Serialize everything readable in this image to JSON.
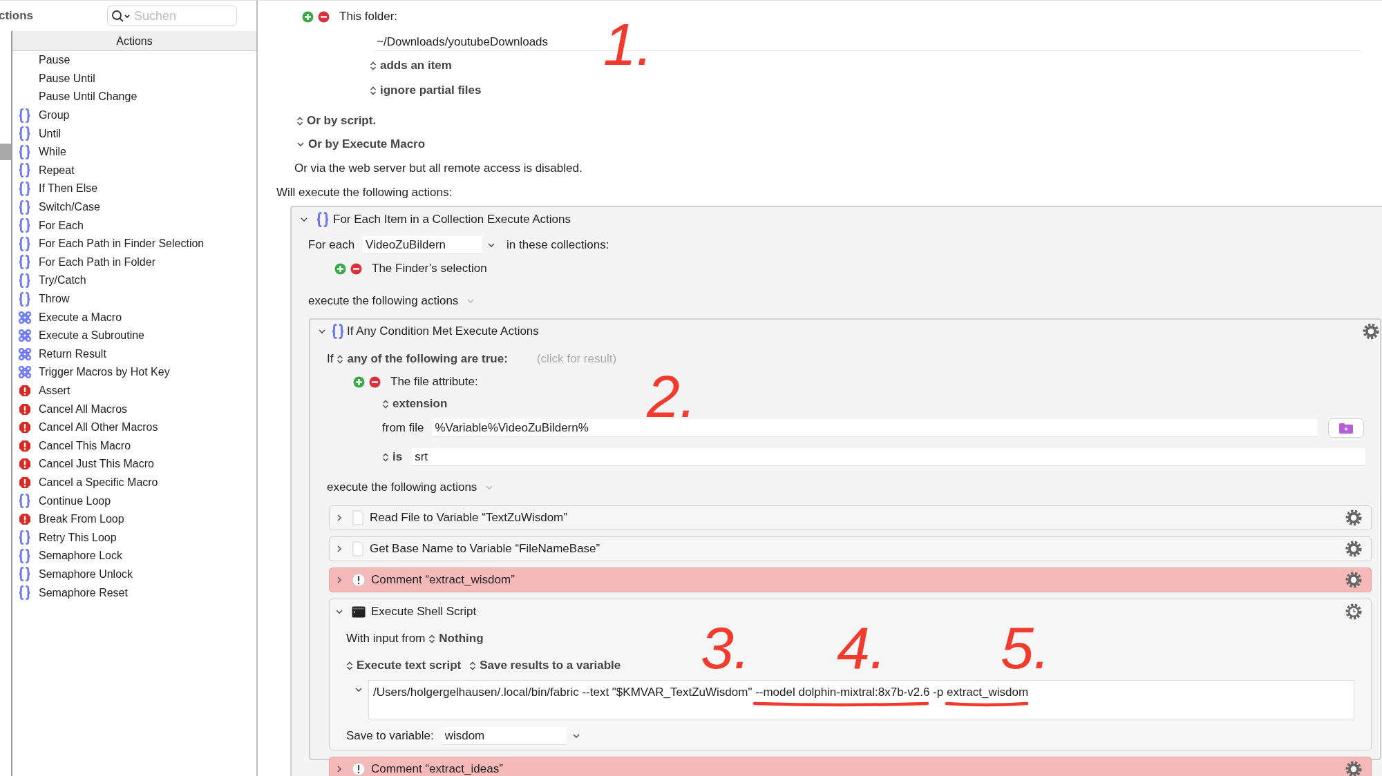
{
  "sidebar": {
    "title": "ctions",
    "search": {
      "placeholder": "Suchen"
    },
    "column_header": "Actions",
    "items": [
      {
        "label": "Pause",
        "kind": "plain"
      },
      {
        "label": "Pause Until",
        "kind": "plain"
      },
      {
        "label": "Pause Until Change",
        "kind": "plain"
      },
      {
        "label": "Group",
        "kind": "braces"
      },
      {
        "label": "Until",
        "kind": "braces"
      },
      {
        "label": "While",
        "kind": "braces"
      },
      {
        "label": "Repeat",
        "kind": "braces"
      },
      {
        "label": "If Then Else",
        "kind": "braces"
      },
      {
        "label": "Switch/Case",
        "kind": "braces"
      },
      {
        "label": "For Each",
        "kind": "braces"
      },
      {
        "label": "For Each Path in Finder Selection",
        "kind": "braces"
      },
      {
        "label": "For Each Path in Folder",
        "kind": "braces"
      },
      {
        "label": "Try/Catch",
        "kind": "braces"
      },
      {
        "label": "Throw",
        "kind": "braces"
      },
      {
        "label": "Execute a Macro",
        "kind": "command"
      },
      {
        "label": "Execute a Subroutine",
        "kind": "command"
      },
      {
        "label": "Return Result",
        "kind": "command"
      },
      {
        "label": "Trigger Macros by Hot Key",
        "kind": "command"
      },
      {
        "label": "Assert",
        "kind": "stop"
      },
      {
        "label": "Cancel All Macros",
        "kind": "stop"
      },
      {
        "label": "Cancel All Other Macros",
        "kind": "stop"
      },
      {
        "label": "Cancel This Macro",
        "kind": "stop"
      },
      {
        "label": "Cancel Just This Macro",
        "kind": "stop"
      },
      {
        "label": "Cancel a Specific Macro",
        "kind": "stop"
      },
      {
        "label": "Continue Loop",
        "kind": "braces"
      },
      {
        "label": "Break From Loop",
        "kind": "stop"
      },
      {
        "label": "Retry This Loop",
        "kind": "braces"
      },
      {
        "label": "Semaphore Lock",
        "kind": "braces"
      },
      {
        "label": "Semaphore Unlock",
        "kind": "braces"
      },
      {
        "label": "Semaphore Reset",
        "kind": "braces"
      }
    ]
  },
  "trigger": {
    "folder_label": "This folder:",
    "folder_path": "~/Downloads/youtubeDownloads",
    "event": "adds an item",
    "option": "ignore partial files",
    "others": [
      {
        "label": "Or by script.",
        "expanded": false
      },
      {
        "label": "Or by Execute Macro",
        "expanded": true
      }
    ],
    "web_note": "Or via the web server but all remote access is disabled."
  },
  "actions_heading": "Will execute the following actions:",
  "for_each": {
    "title": "For Each Item in a Collection Execute Actions",
    "expanded": true,
    "for_label": "For each",
    "variable": "VideoZuBildern",
    "collections_label": "in these collections:",
    "collections": [
      "The Finder’s selection"
    ],
    "execute_label": "execute the following actions",
    "condition": {
      "title": "If Any Condition Met Execute Actions",
      "expanded": true,
      "if_label": "If",
      "match": "any of the following are true:",
      "result_hint": "(click for result)",
      "condition_label": "The file attribute:",
      "attribute": "extension",
      "from_label": "from file",
      "from_value": "%Variable%VideoZuBildern%",
      "operator": "is",
      "value": "srt",
      "execute_label": "execute the following actions",
      "actions": [
        {
          "kind": "file",
          "title": "Read File to Variable “TextZuWisdom”",
          "expanded": false
        },
        {
          "kind": "file",
          "title": "Get Base Name to Variable “FileNameBase”",
          "expanded": false
        },
        {
          "kind": "comment",
          "title": "Comment “extract_wisdom”",
          "expanded": false
        },
        {
          "kind": "shell",
          "title": "Execute Shell Script",
          "expanded": true,
          "input_label": "With input from",
          "input": "Nothing",
          "mode": "Execute text script",
          "output": "Save results to a variable",
          "script": "/Users/holgergelhausen/.local/bin/fabric --text \"$KMVAR_TextZuWisdom\" --model dolphin-mixtral:8x7b-v2.6 -p extract_wisdom",
          "save_label": "Save to variable:",
          "save_variable": "wisdom"
        },
        {
          "kind": "comment",
          "title": "Comment “extract_ideas”",
          "expanded": false
        }
      ]
    }
  },
  "annotations": [
    "1.",
    "2.",
    "3.",
    "4.",
    "5."
  ]
}
